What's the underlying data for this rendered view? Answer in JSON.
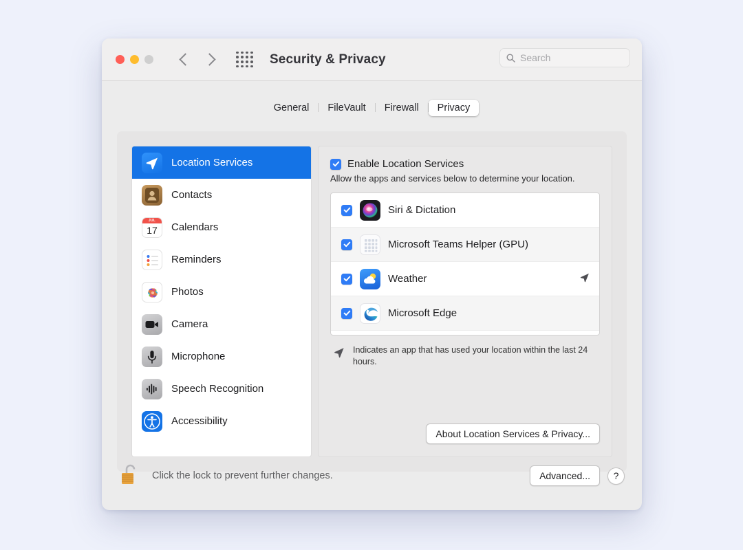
{
  "window": {
    "title": "Security & Privacy",
    "traffic_lights": [
      "close",
      "minimize",
      "zoom"
    ],
    "nav": {
      "back": "back-chevron",
      "forward": "forward-chevron",
      "grid": "show-all-grid"
    },
    "search": {
      "placeholder": "Search",
      "value": "",
      "icon": "search-icon"
    }
  },
  "tabs": [
    {
      "label": "General",
      "selected": false
    },
    {
      "label": "FileVault",
      "selected": false
    },
    {
      "label": "Firewall",
      "selected": false
    },
    {
      "label": "Privacy",
      "selected": true
    }
  ],
  "sidebar": {
    "items": [
      {
        "label": "Location Services",
        "icon": "location-services-icon",
        "selected": true
      },
      {
        "label": "Contacts",
        "icon": "contacts-icon",
        "selected": false
      },
      {
        "label": "Calendars",
        "icon": "calendars-icon",
        "selected": false,
        "icon_month": "JUL",
        "icon_day": "17"
      },
      {
        "label": "Reminders",
        "icon": "reminders-icon",
        "selected": false
      },
      {
        "label": "Photos",
        "icon": "photos-icon",
        "selected": false
      },
      {
        "label": "Camera",
        "icon": "camera-icon",
        "selected": false
      },
      {
        "label": "Microphone",
        "icon": "microphone-icon",
        "selected": false
      },
      {
        "label": "Speech Recognition",
        "icon": "speech-recognition-icon",
        "selected": false
      },
      {
        "label": "Accessibility",
        "icon": "accessibility-icon",
        "selected": false
      }
    ]
  },
  "main": {
    "enable": {
      "label": "Enable Location Services",
      "checked": true
    },
    "description": "Allow the apps and services below to determine your location.",
    "apps": [
      {
        "name": "Siri & Dictation",
        "checked": true,
        "icon": "siri-icon",
        "recent_location": false
      },
      {
        "name": "Microsoft Teams Helper (GPU)",
        "checked": true,
        "icon": "generic-app-icon",
        "recent_location": false
      },
      {
        "name": "Weather",
        "checked": true,
        "icon": "weather-icon",
        "recent_location": true
      },
      {
        "name": "Microsoft Edge",
        "checked": true,
        "icon": "microsoft-edge-icon",
        "recent_location": false
      }
    ],
    "footnote": "Indicates an app that has used your location within the last 24 hours.",
    "footnote_icon": "location-arrow-icon",
    "about_button": "About Location Services & Privacy..."
  },
  "footer": {
    "lock_icon": "unlocked-padlock-icon",
    "lock_text": "Click the lock to prevent further changes.",
    "advanced_button": "Advanced...",
    "help_button": "?"
  },
  "colors": {
    "accent": "#1473e6",
    "checkbox": "#2f7cf6",
    "page_bg": "#eef1fb"
  }
}
